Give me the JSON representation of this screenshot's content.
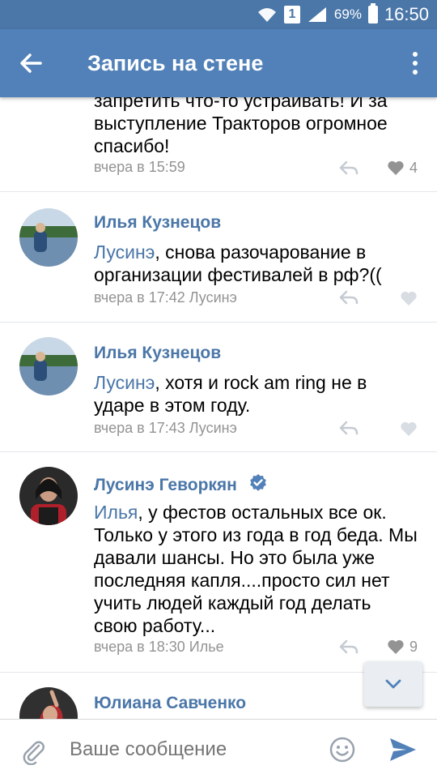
{
  "status_bar": {
    "sim_label": "1",
    "battery": "69%",
    "time": "16:50",
    "icons": [
      "wifi-icon",
      "signal-icon",
      "battery-icon"
    ]
  },
  "toolbar": {
    "title": "Запись на стене",
    "back_icon": "arrow-back-icon",
    "more_icon": "more-vertical-icon"
  },
  "colors": {
    "header": "#5181b8",
    "status_bar": "#4a76a8",
    "link": "#4a76a8",
    "meta": "#939393",
    "send": "#5181b8"
  },
  "comments": [
    {
      "author": "",
      "text_lines": [
        "запретить что-то устраивать! И за",
        "выступление Тракторов огромное",
        "спасибо!"
      ],
      "time": "вчера в 15:59",
      "reply_to": "",
      "likes": "4",
      "liked_count_visible": true
    },
    {
      "author": "Илья Кузнецов",
      "mention": "Лусинэ",
      "text": ", снова разочарование в организации фестивалей в рф?((",
      "time": "вчера в 17:42",
      "reply_to": "Лусинэ",
      "likes": ""
    },
    {
      "author": "Илья Кузнецов",
      "mention": "Лусинэ",
      "text": ", хотя и rock am ring не в ударе в этом году.",
      "time": "вчера в 17:43",
      "reply_to": "Лусинэ",
      "likes": ""
    },
    {
      "author": "Лусинэ Геворкян",
      "verified": true,
      "mention": "Илья",
      "text": ", у фестов остальных все ок. Только у этого из года в год беда. Мы давали шансы. Но это была уже последняя капля....просто сил нет учить людей каждый год делать свою работу...",
      "time": "вчера в 18:30",
      "reply_to": "Илье",
      "likes": "9"
    },
    {
      "author": "Юлиана Савченко"
    }
  ],
  "composer": {
    "placeholder": "Ваше сообщение",
    "attach_icon": "paperclip-icon",
    "emoji_icon": "smile-icon",
    "send_icon": "send-icon"
  },
  "scroll_fab_icon": "chevron-down-icon"
}
